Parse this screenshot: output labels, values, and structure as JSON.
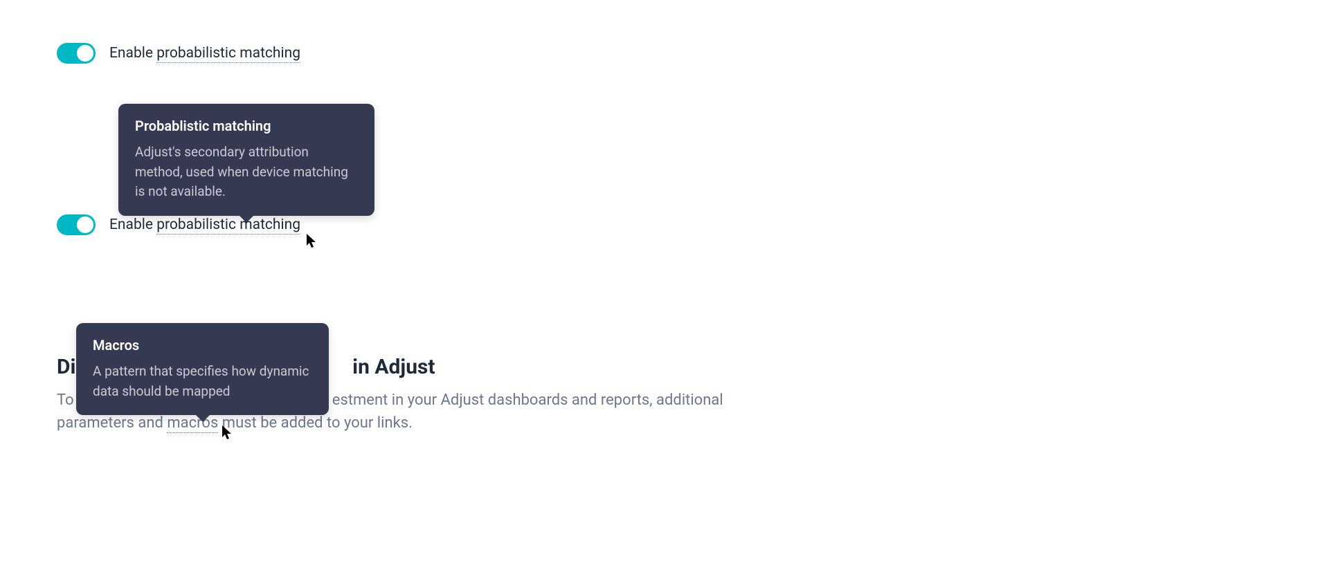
{
  "toggle1": {
    "label_prefix": "Enable ",
    "term": "probabilistic matching"
  },
  "tooltip1": {
    "title": "Probablistic matching",
    "body": "Adjust's secondary attribution method, used when device matching is not available."
  },
  "toggle2": {
    "label_prefix": "Enable ",
    "term": "probabilistic matching"
  },
  "tooltip2": {
    "title": "Macros",
    "body": "A pattern that specifies how dynamic data should be mapped"
  },
  "section": {
    "heading_prefix": "Di",
    "heading_suffix": " in Adjust",
    "body_prefix": "To ",
    "body_mid": "estment in your Adjust dashboards and reports, additional parameters and ",
    "term": "macros",
    "body_suffix": " must be added to your links."
  }
}
